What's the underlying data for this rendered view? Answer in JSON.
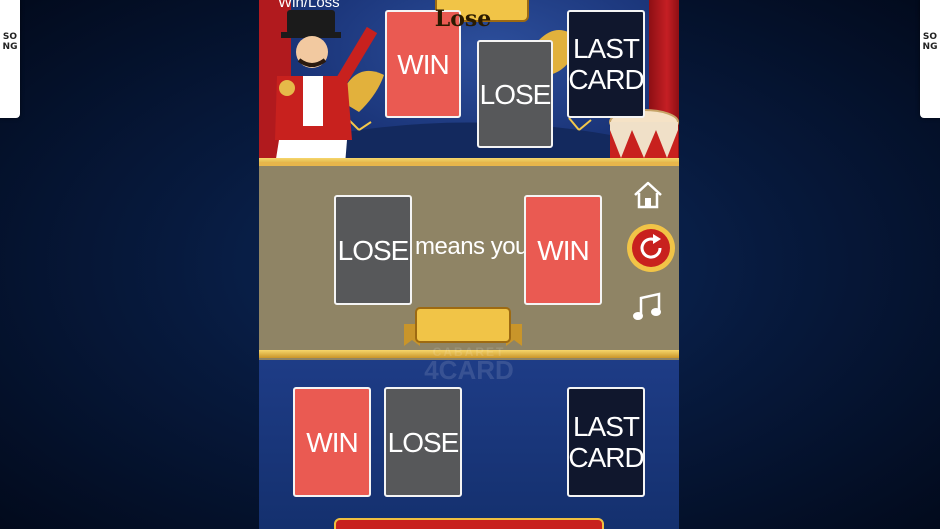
{
  "side_tabs": {
    "left": "SONG",
    "right": "SONG"
  },
  "top_label": "Win/Loss",
  "top_cards": [
    {
      "type": "win",
      "label": "WIN"
    },
    {
      "type": "lose",
      "label": "LOSE"
    },
    {
      "type": "last",
      "label": "LAST CARD"
    }
  ],
  "rule": {
    "left_card": "LOSE",
    "text": "means you",
    "right_card": "WIN"
  },
  "banner": "Lose",
  "watermark": {
    "brand": "CABARET",
    "title": "4CARD"
  },
  "hand_cards": [
    {
      "type": "win",
      "label": "WIN"
    },
    {
      "type": "lose",
      "label": "LOSE"
    },
    {
      "type": "last",
      "label": "LAST CARD"
    }
  ],
  "controls": [
    "home-icon",
    "restart-icon",
    "music-note-icon"
  ],
  "colors": {
    "win": "#ea5a52",
    "lose": "#57585a",
    "last": "#10172d",
    "gold": "#f1c447",
    "restart": "#c8211e"
  }
}
